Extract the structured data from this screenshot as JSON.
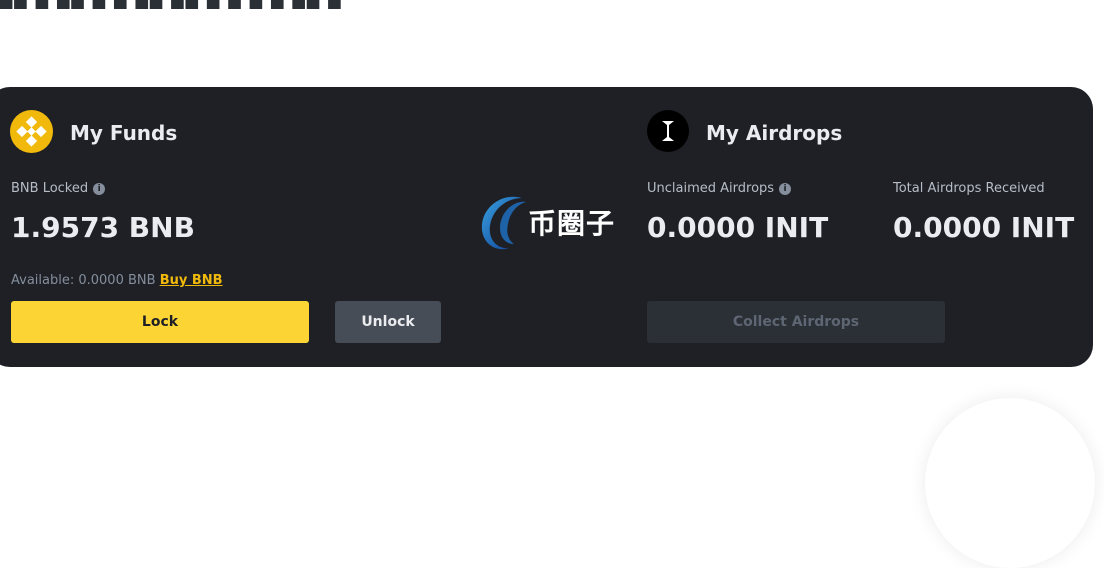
{
  "funds": {
    "title": "My Funds",
    "icon": "bnb-icon",
    "locked_label": "BNB Locked",
    "locked_value": "1.9573 BNB",
    "available_text": "Available: 0.0000 BNB",
    "buy_link": "Buy BNB",
    "lock_button": "Lock",
    "unlock_button": "Unlock"
  },
  "airdrops": {
    "title": "My Airdrops",
    "icon": "initia-icon",
    "unclaimed_label": "Unclaimed Airdrops",
    "unclaimed_value": "0.0000 INIT",
    "total_label": "Total Airdrops Received",
    "total_value": "0.0000 INIT",
    "collect_button": "Collect Airdrops"
  },
  "watermark": {
    "text": "币圈子"
  },
  "colors": {
    "card_bg": "#1e2026",
    "accent_yellow": "#fcd535",
    "bnb_gold": "#f0b90b",
    "secondary_button": "#474d57",
    "disabled_button": "#2b2f36",
    "text_primary": "#eaecef",
    "text_secondary": "#b7bdc6",
    "text_muted": "#848e9c"
  }
}
